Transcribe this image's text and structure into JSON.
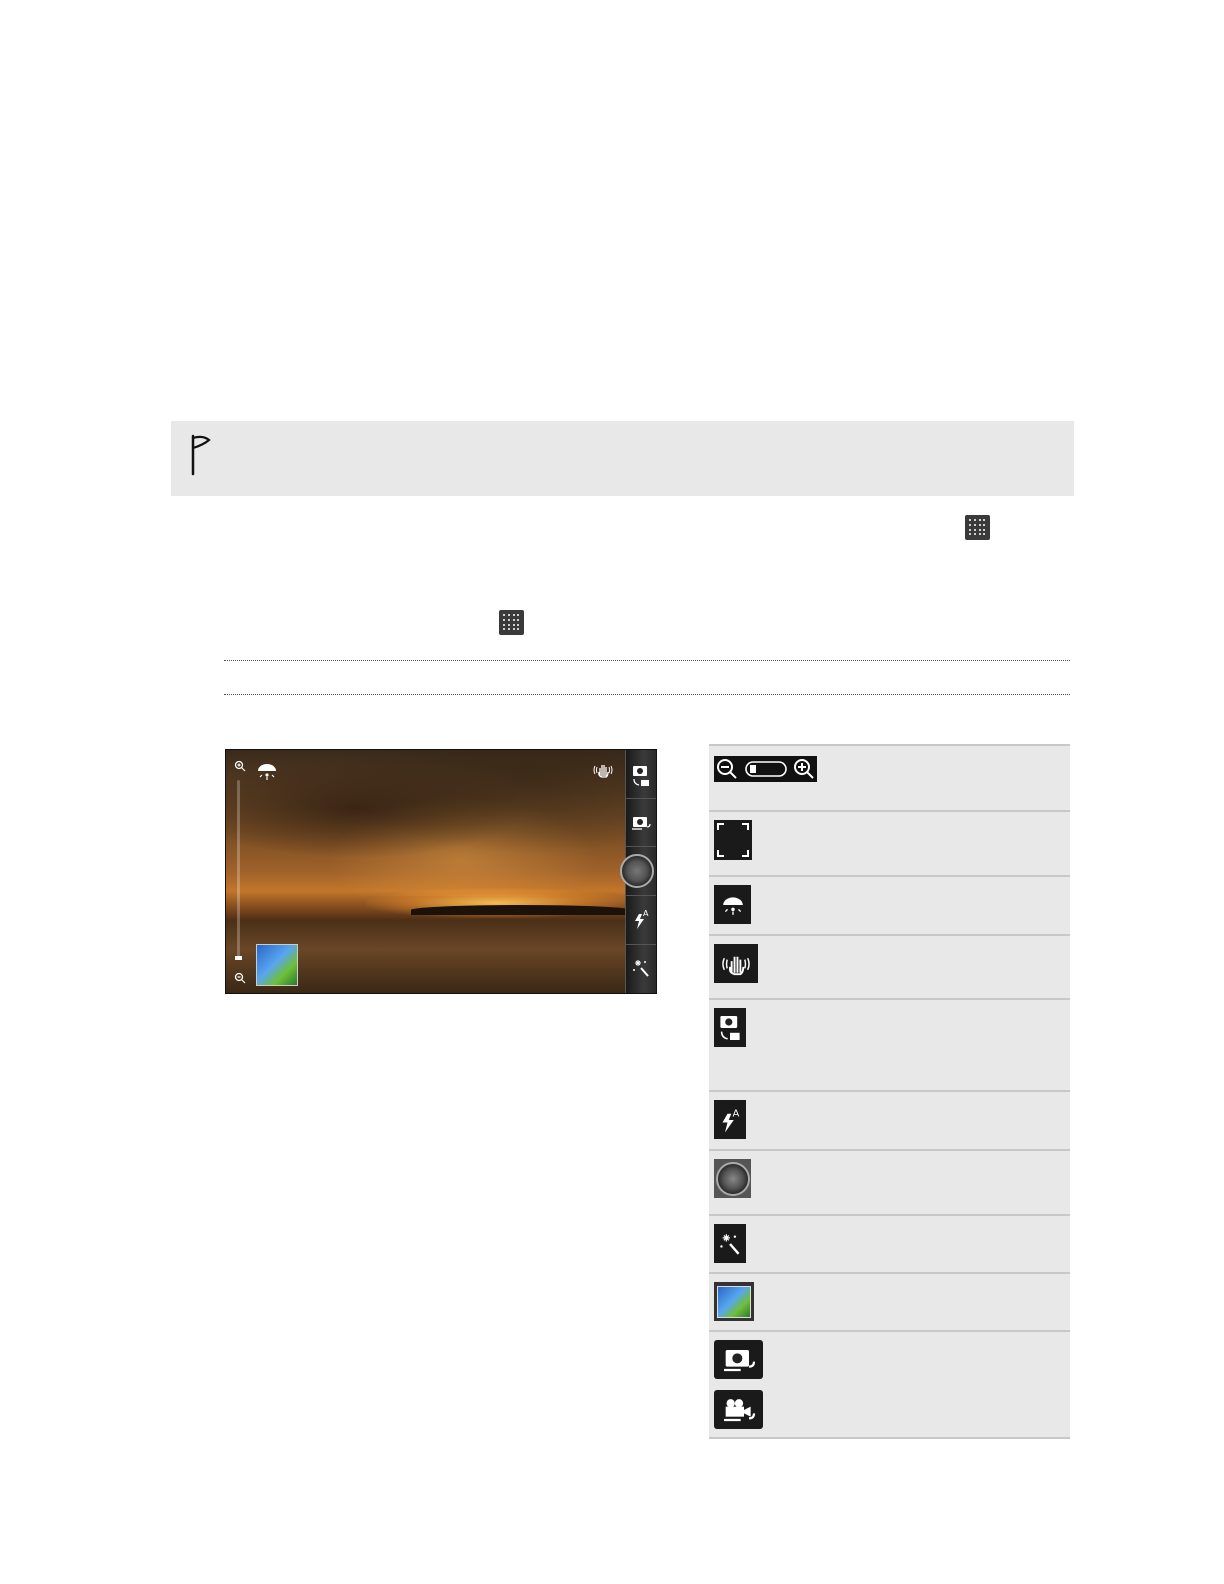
{
  "note": {
    "flag_icon": "flag-icon"
  },
  "icons": {
    "apps": "all-apps-icon"
  },
  "camera_screen": {
    "zoom_in_icon": "zoom-in-icon",
    "zoom_out_icon": "zoom-out-icon",
    "scene_icon": "scene-icon",
    "stabilizer_icon": "image-stabilizer-icon",
    "mode_icon": "camera-video-switch-icon",
    "front_rear_icon": "front-rear-camera-icon",
    "shutter_icon": "shutter-release-icon",
    "flash_icon": "flash-auto-icon",
    "effects_icon": "effects-icon",
    "thumbnail": "gallery-thumbnail"
  },
  "icon_table": [
    {
      "icon": "zoom-bar-icon"
    },
    {
      "icon": "auto-focus-frame-icon"
    },
    {
      "icon": "scene-icon"
    },
    {
      "icon": "image-stabilizer-icon"
    },
    {
      "icon": "camera-video-switch-icon"
    },
    {
      "icon": "flash-auto-icon"
    },
    {
      "icon": "shutter-release-icon"
    },
    {
      "icon": "effects-icon"
    },
    {
      "icon": "gallery-thumbnail-icon"
    },
    {
      "icon": "front-rear-camera-icon"
    }
  ]
}
